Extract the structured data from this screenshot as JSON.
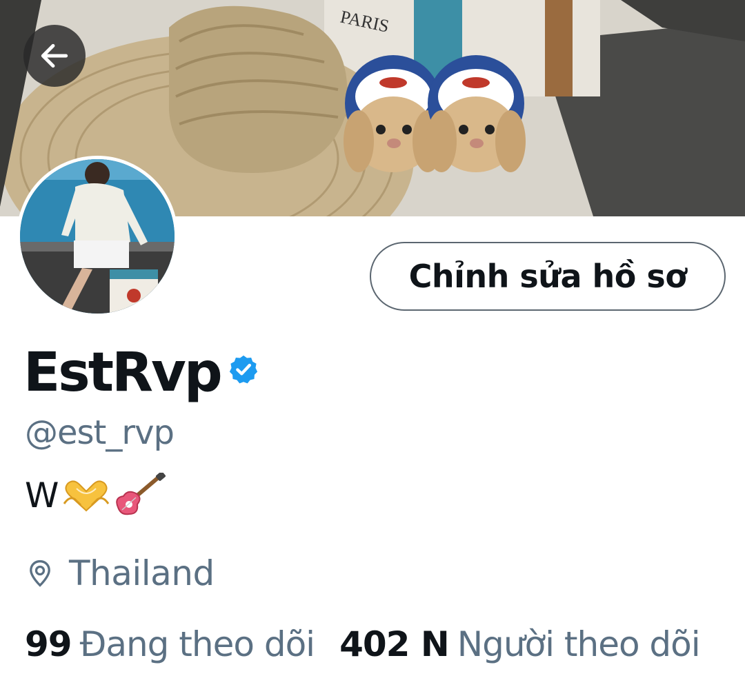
{
  "header": {
    "back_icon": "arrow-left-icon",
    "banner_text": "PARIS"
  },
  "profile": {
    "edit_label": "Chỉnh sửa hồ sơ",
    "display_name": "EstRvp",
    "verified_icon": "verified-badge-icon",
    "handle": "@est_rvp",
    "bio_text": "W",
    "bio_emojis": [
      "heart-hands-icon",
      "guitar-icon"
    ],
    "location_icon": "location-pin-icon",
    "location": "Thailand"
  },
  "stats": {
    "following_count": "99",
    "following_label": "Đang theo dõi",
    "followers_count": "402 N",
    "followers_label": "Người theo dõi"
  },
  "colors": {
    "verified": "#1d9bf0",
    "secondary_text": "#5b7083",
    "primary_text": "#0f1419",
    "button_border": "#5b6670"
  }
}
